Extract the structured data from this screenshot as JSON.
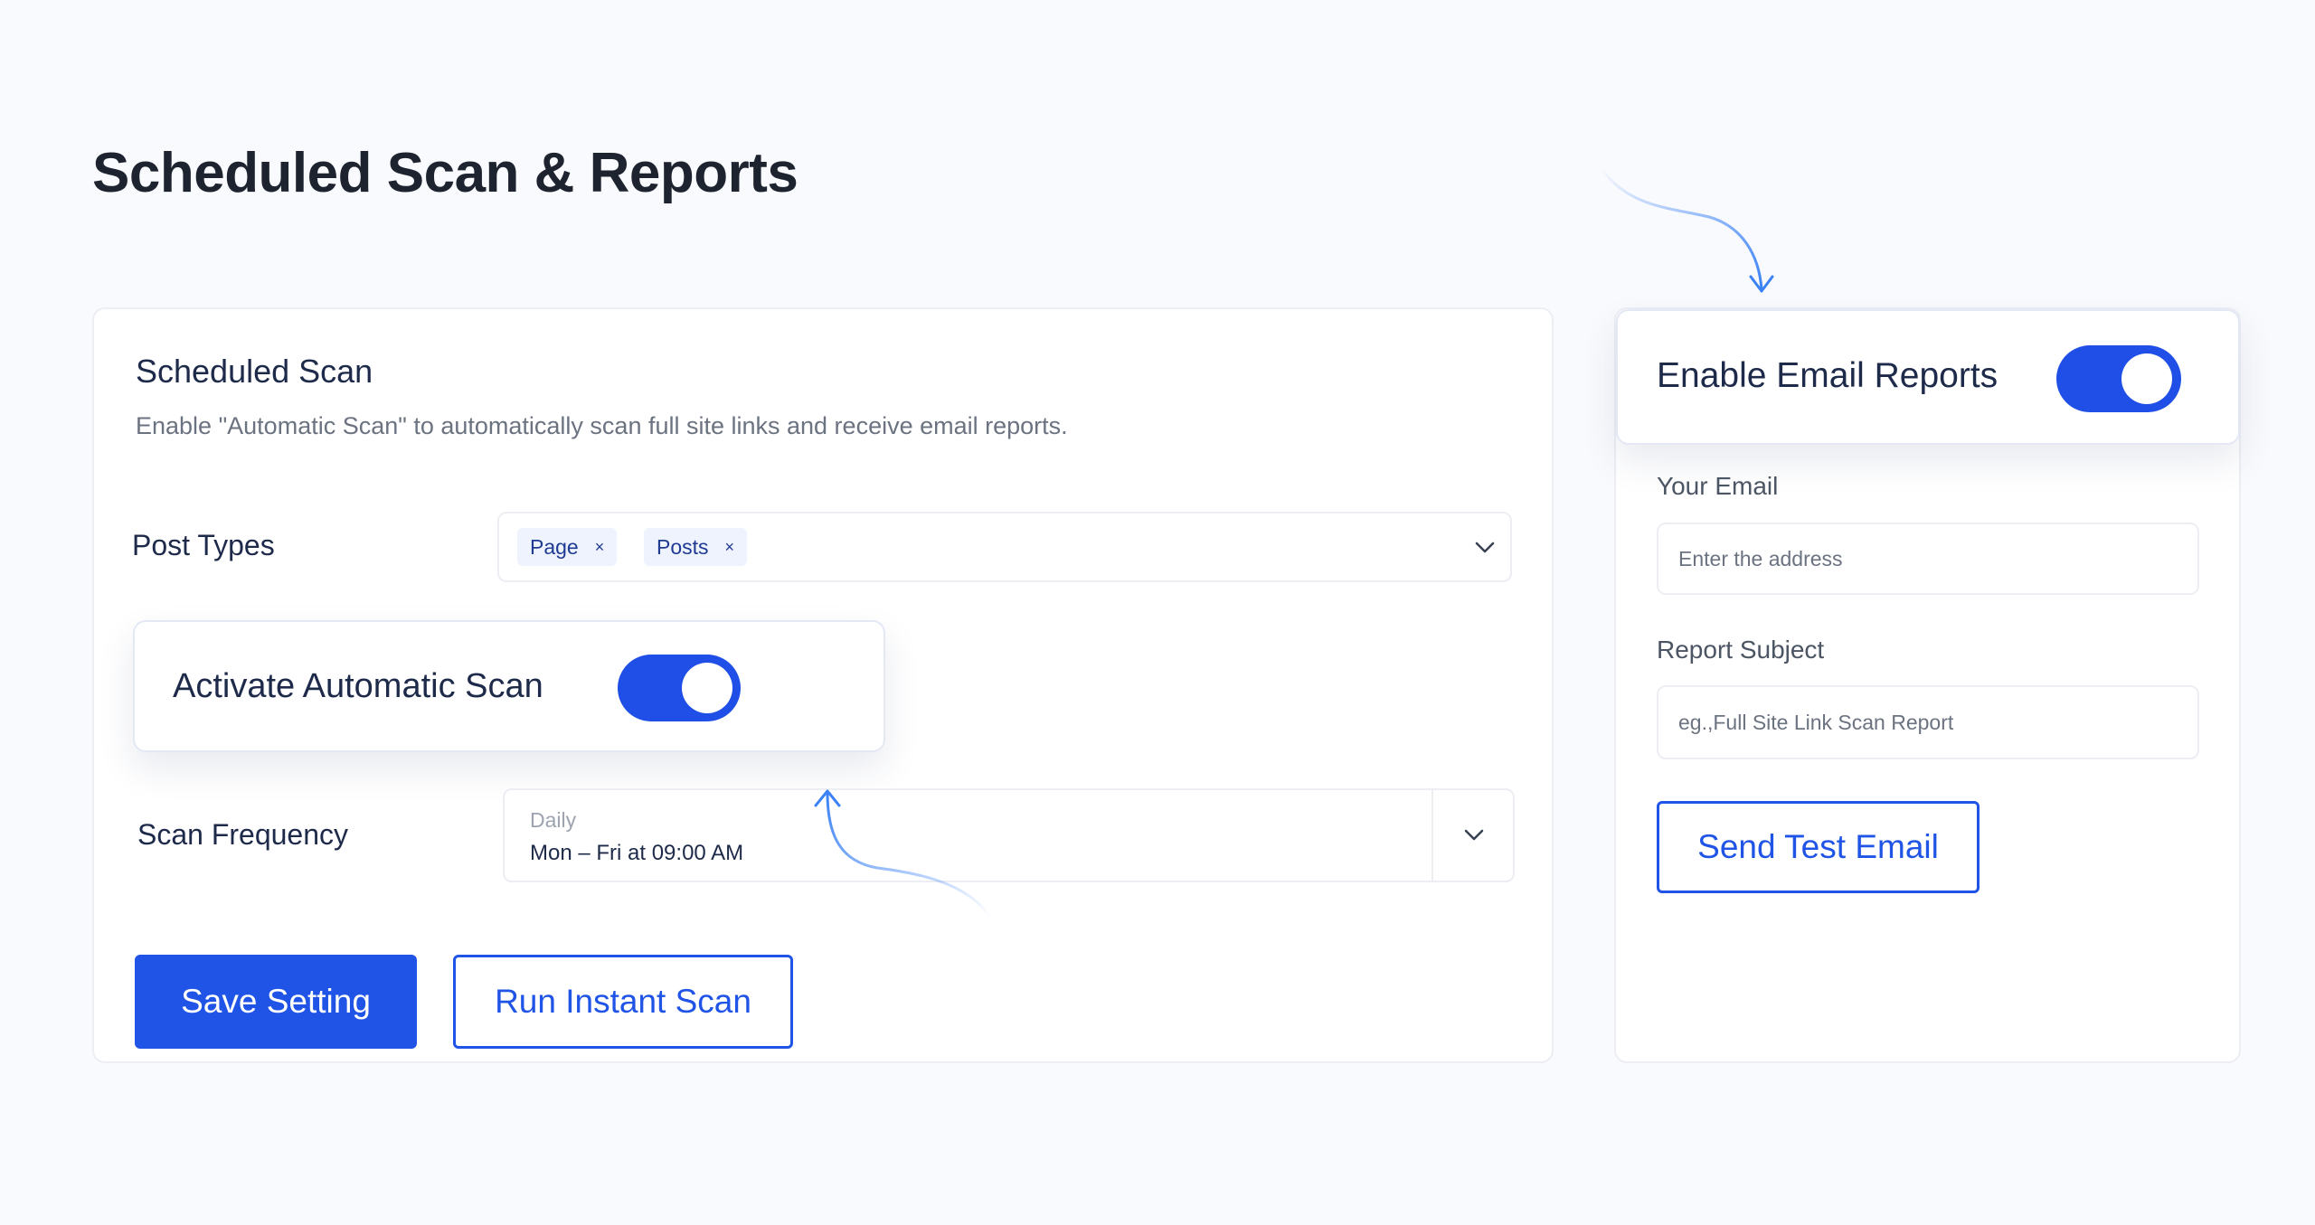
{
  "page": {
    "title": "Scheduled Scan & Reports"
  },
  "scheduled_scan": {
    "title": "Scheduled Scan",
    "description": "Enable \"Automatic Scan\" to automatically scan full site links and receive email reports.",
    "post_types": {
      "label": "Post Types",
      "chips": [
        "Page",
        "Posts"
      ],
      "chip_remove": "×"
    },
    "auto_scan": {
      "label": "Activate Automatic Scan",
      "enabled": true
    },
    "frequency": {
      "label": "Scan Frequency",
      "selected": "Daily",
      "schedule": "Mon – Fri at 09:00 AM"
    },
    "buttons": {
      "save": "Save Setting",
      "run": "Run Instant Scan"
    }
  },
  "email_reports": {
    "toggle_label": "Enable Email Reports",
    "enabled": true,
    "email": {
      "label": "Your Email",
      "placeholder": "Enter the address",
      "value": ""
    },
    "subject": {
      "label": "Report Subject",
      "placeholder": "eg.,Full Site Link Scan Report",
      "value": ""
    },
    "test_button": "Send Test Email"
  },
  "colors": {
    "accent": "#1f54e6",
    "toggle_on": "#1f4fe6",
    "arrow": "#3b82f6"
  },
  "icons": {
    "chevron": "chevron-down-icon",
    "arrow": "curved-arrow-icon"
  }
}
